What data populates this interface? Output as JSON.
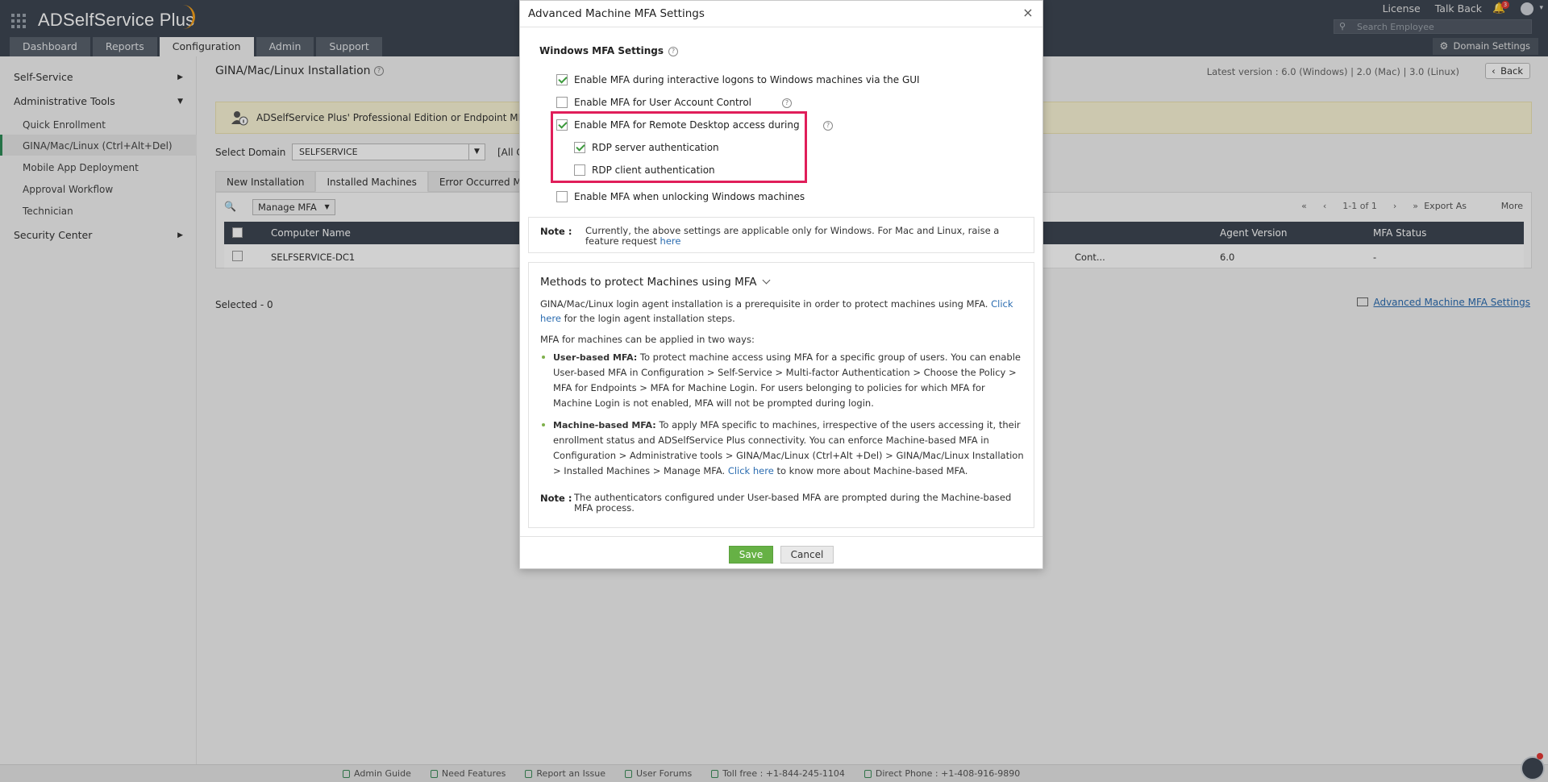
{
  "app": {
    "brand": "ADSelfService Plus",
    "top_links": [
      "License",
      "Talk Back"
    ],
    "notification_count": "3",
    "search_placeholder": "Search Employee",
    "main_tabs": [
      "Dashboard",
      "Reports",
      "Configuration",
      "Admin",
      "Support"
    ],
    "domain_settings": "Domain Settings"
  },
  "sidebar": {
    "groups": [
      "Self-Service",
      "Administrative Tools",
      "Security Center"
    ],
    "items": [
      "Quick Enrollment",
      "GINA/Mac/Linux (Ctrl+Alt+Del)",
      "Mobile App Deployment",
      "Approval Workflow",
      "Technician"
    ]
  },
  "page": {
    "title": "GINA/Mac/Linux Installation",
    "version_info": "Latest version : 6.0 (Windows) | 2.0 (Mac) | 3.0 (Linux)",
    "back": "Back",
    "banner": "ADSelfService Plus' Professional Edition or Endpoint MFA A",
    "select_domain_label": "Select Domain",
    "domain_value": "SELFSERVICE",
    "all_c": "[All C",
    "sub_tabs": [
      "New Installation",
      "Installed Machines",
      "Error Occurred Mac"
    ],
    "manage_mfa": "Manage MFA",
    "pager": {
      "first": "«",
      "prev": "‹",
      "range": "1-1 of 1",
      "next": "›",
      "last": "»"
    },
    "export_as": "Export As",
    "more": "More",
    "columns": {
      "computer": "Computer Name",
      "agent": "Agent Version",
      "mfa": "MFA Status"
    },
    "row": {
      "computer": "SELFSERVICE-DC1",
      "mid": "Cont...",
      "agent": "6.0",
      "mfa": "-"
    },
    "selected_count": "Selected - 0",
    "advanced_link": "Advanced Machine MFA Settings"
  },
  "modal": {
    "title": "Advanced Machine MFA Settings",
    "close": "×",
    "section_heading": "Windows MFA Settings",
    "options": {
      "interactive": {
        "label": "Enable MFA during interactive logons to Windows machines via the GUI",
        "checked": true
      },
      "uac": {
        "label": "Enable MFA for User Account Control",
        "checked": false
      },
      "rdp": {
        "label": "Enable MFA for Remote Desktop access during",
        "checked": true
      },
      "rdp_server": {
        "label": "RDP server authentication",
        "checked": true
      },
      "rdp_client": {
        "label": "RDP client authentication",
        "checked": false
      },
      "unlock": {
        "label": "Enable MFA when unlocking Windows machines",
        "checked": false
      }
    },
    "note": {
      "label": "Note :",
      "text": "Currently, the above settings are applicable only for Windows. For Mac and Linux, raise a feature request ",
      "link": "here"
    },
    "methods": {
      "title": "Methods to protect Machines using MFA",
      "intro_text": "GINA/Mac/Linux login agent installation is a prerequisite in order to protect machines using MFA. ",
      "intro_link": "Click here",
      "intro_tail": " for the login agent installation steps.",
      "ways": "MFA for machines can be applied in two ways:",
      "user_based_title": "User-based MFA:",
      "user_based_text": " To protect machine access using MFA for a specific group of users. You can enable User-based MFA in Configuration > Self-Service > Multi-factor Authentication > Choose the Policy > MFA for Endpoints > MFA for Machine Login. For users belonging to policies for which MFA for Machine Login is not enabled, MFA will not be prompted during login.",
      "machine_based_title": "Machine-based MFA:",
      "machine_based_text": " To apply MFA specific to machines, irrespective of the users accessing it, their enrollment status and ADSelfService Plus connectivity. You can enforce Machine-based MFA in Configuration > Administrative tools > GINA/Mac/Linux (Ctrl+Alt +Del) > GINA/Mac/Linux Installation > Installed Machines > Manage MFA. ",
      "machine_based_link": "Click here",
      "machine_based_tail": " to know more about Machine-based MFA.",
      "note_label": "Note :",
      "note_text": "The authenticators configured under User-based MFA are prompted during the Machine-based MFA process."
    },
    "save": "Save",
    "cancel": "Cancel"
  },
  "footer": [
    "Admin Guide",
    "Need Features",
    "Report an Issue",
    "User Forums",
    "Toll free : +1-844-245-1104",
    "Direct Phone : +1-408-916-9890"
  ],
  "colors": {
    "topbar": "#3e4652",
    "accent_green": "#66b145",
    "highlight": "#e01e5a",
    "link": "#2b6cb0"
  }
}
